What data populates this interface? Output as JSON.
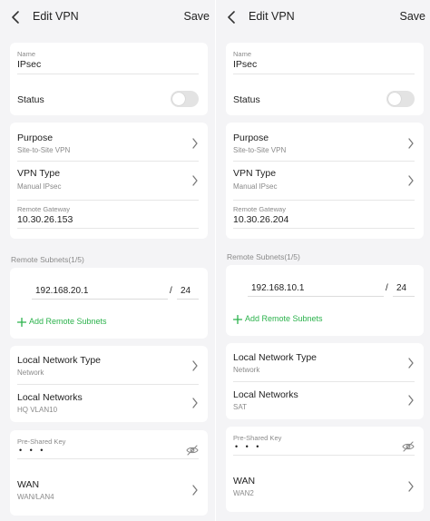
{
  "colors": {
    "accent": "#2bb24c",
    "background": "#f4f4f6",
    "card": "#ffffff",
    "secondary_text": "#8a8a8a"
  },
  "panels": [
    {
      "header": {
        "title": "Edit VPN",
        "save_label": "Save"
      },
      "name": {
        "label": "Name",
        "value": "IPsec"
      },
      "status": {
        "label": "Status",
        "enabled": false
      },
      "purpose": {
        "label": "Purpose",
        "value": "Site-to-Site VPN"
      },
      "vpn_type": {
        "label": "VPN Type",
        "value": "Manual IPsec"
      },
      "remote_gateway": {
        "label": "Remote Gateway",
        "value": "10.30.26.153"
      },
      "remote_subnets": {
        "label": "Remote Subnets(1/5)",
        "ip": "192.168.20.1",
        "slash": "/",
        "mask": "24",
        "add_label": "Add Remote Subnets"
      },
      "local_network_type": {
        "label": "Local Network Type",
        "value": "Network"
      },
      "local_networks": {
        "label": "Local Networks",
        "value": "HQ VLAN10"
      },
      "pre_shared_key": {
        "label": "Pre-Shared Key",
        "value": "• • •",
        "icon": "eye-off-icon"
      },
      "wan": {
        "label": "WAN",
        "value": "WAN/LAN4"
      }
    },
    {
      "header": {
        "title": "Edit VPN",
        "save_label": "Save"
      },
      "name": {
        "label": "Name",
        "value": "IPsec"
      },
      "status": {
        "label": "Status",
        "enabled": false
      },
      "purpose": {
        "label": "Purpose",
        "value": "Site-to-Site VPN"
      },
      "vpn_type": {
        "label": "VPN Type",
        "value": "Manual IPsec"
      },
      "remote_gateway": {
        "label": "Remote Gateway",
        "value": "10.30.26.204"
      },
      "remote_subnets": {
        "label": "Remote Subnets(1/5)",
        "ip": "192.168.10.1",
        "slash": "/",
        "mask": "24",
        "add_label": "Add Remote Subnets"
      },
      "local_network_type": {
        "label": "Local Network Type",
        "value": "Network"
      },
      "local_networks": {
        "label": "Local Networks",
        "value": "SAT"
      },
      "pre_shared_key": {
        "label": "Pre-Shared Key",
        "value": "• • •",
        "icon": "eye-off-icon"
      },
      "wan": {
        "label": "WAN",
        "value": "WAN2"
      }
    }
  ]
}
